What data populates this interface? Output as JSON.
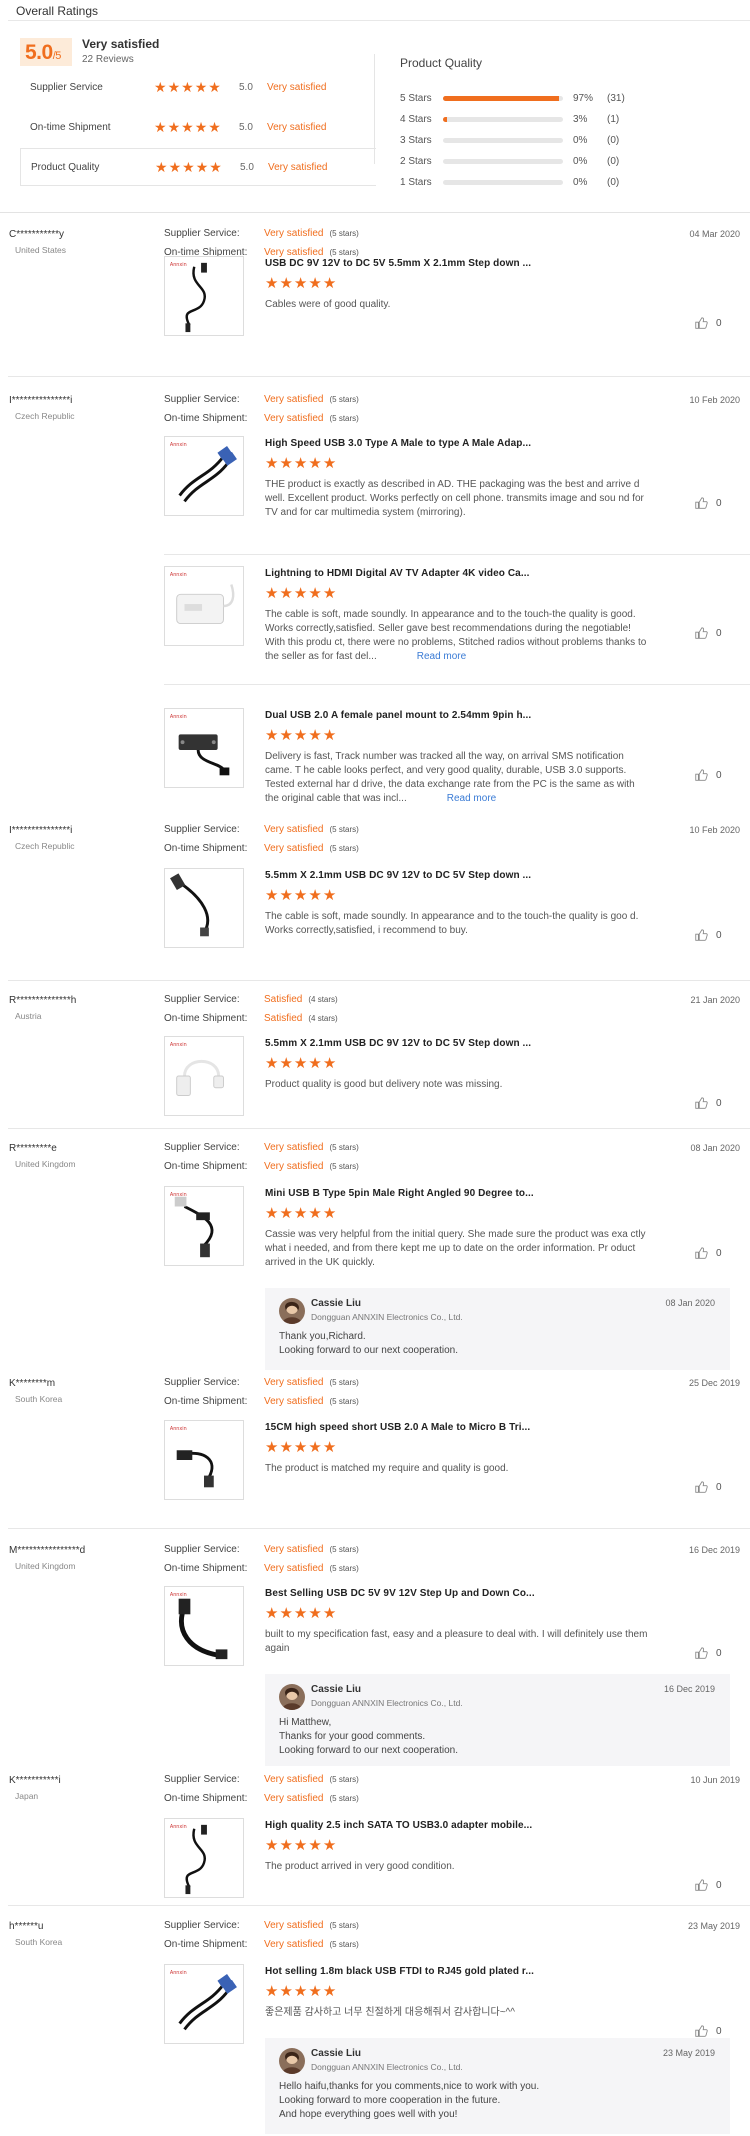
{
  "header": {
    "title": "Overall Ratings",
    "score": "5.0",
    "score_suffix": "/5",
    "score_label": "Very satisfied",
    "review_count": "22 Reviews"
  },
  "ratings": [
    {
      "label": "Supplier Service",
      "value": "5.0",
      "text": "Very satisfied"
    },
    {
      "label": "On-time Shipment",
      "value": "5.0",
      "text": "Very satisfied"
    },
    {
      "label": "Product Quality",
      "value": "5.0",
      "text": "Very satisfied"
    }
  ],
  "product_quality": {
    "title": "Product Quality",
    "bars": [
      {
        "label": "5 Stars",
        "fraction": 0.97,
        "pct": "97%",
        "count": "(31)"
      },
      {
        "label": "4 Stars",
        "fraction": 0.03,
        "pct": "3%",
        "count": "(1)"
      },
      {
        "label": "3 Stars",
        "fraction": 0,
        "pct": "0%",
        "count": "(0)"
      },
      {
        "label": "2 Stars",
        "fraction": 0,
        "pct": "0%",
        "count": "(0)"
      },
      {
        "label": "1 Stars",
        "fraction": 0,
        "pct": "0%",
        "count": "(0)"
      }
    ]
  },
  "labels": {
    "supplier_service": "Supplier Service:",
    "on_time_shipment": "On-time Shipment:",
    "read_more": "Read more"
  },
  "reviews": [
    {
      "user": "C***********y",
      "country": "United States",
      "date": "04 Mar 2020",
      "service": "Very satisfied",
      "service_stars": "(5 stars)",
      "shipment": "Very satisfied",
      "shipment_stars": "(5 stars)",
      "products": [
        {
          "name": "USB DC 9V 12V to DC 5V 5.5mm X 2.1mm Step down ...",
          "rating": 5,
          "text": "Cables were of good quality.",
          "likes": "0"
        }
      ]
    },
    {
      "user": "I***************i",
      "country": "Czech Republic",
      "date": "10 Feb 2020",
      "service": "Very satisfied",
      "service_stars": "(5 stars)",
      "shipment": "Very satisfied",
      "shipment_stars": "(5 stars)",
      "products": [
        {
          "name": "High Speed USB 3.0 Type A Male to type A Male Adap...",
          "rating": 5,
          "text": "THE product is exactly as described in AD. THE packaging was the best and arrive d well.  Excellent product. Works perfectly on cell phone. transmits image and sou nd for TV and for car multimedia system (mirroring).",
          "likes": "0"
        },
        {
          "name": "Lightning to HDMI Digital AV TV Adapter 4K video Ca...",
          "rating": 5,
          "text": "The cable is soft, made soundly. In appearance and to the touch-the quality is good. Works correctly,satisfied. Seller gave best recommendations during the negotiable! With this produ ct, there were no problems, Stitched radios without problems thanks to the seller as for fast del...",
          "likes": "0"
        },
        {
          "name": "Dual USB 2.0 A female panel mount to 2.54mm 9pin h...",
          "rating": 5,
          "text": "Delivery is fast,   Track number was tracked all the way, on arrival SMS notification came. T he cable looks perfect, and very good quality, durable, USB 3.0 supports. Tested external har d drive, the data exchange rate from the PC is the same as with the original cable that was incl...",
          "likes": "0"
        }
      ]
    },
    {
      "user": "I***************i",
      "country": "Czech Republic",
      "date": "10 Feb 2020",
      "service": "Very satisfied",
      "service_stars": "(5 stars)",
      "shipment": "Very satisfied",
      "shipment_stars": "(5 stars)",
      "products": [
        {
          "name": "5.5mm X 2.1mm USB DC 9V 12V to DC 5V Step down ...",
          "rating": 5,
          "text": "The cable is soft, made soundly. In appearance and to the touch-the quality is goo d. Works correctly,satisfied, i recommend to buy.",
          "likes": "0"
        }
      ]
    },
    {
      "user": "R**************h",
      "country": "Austria",
      "date": "21 Jan 2020",
      "service": "Satisfied",
      "service_stars": "(4 stars)",
      "shipment": "Satisfied",
      "shipment_stars": "(4 stars)",
      "products": [
        {
          "name": "5.5mm X 2.1mm USB DC 9V 12V to DC 5V Step down ...",
          "rating": 5,
          "text": "Product quality is good but delivery note was missing.",
          "likes": "0"
        }
      ]
    },
    {
      "user": "R*********e",
      "country": "United Kingdom",
      "date": "08 Jan 2020",
      "service": "Very satisfied",
      "service_stars": "(5 stars)",
      "shipment": "Very satisfied",
      "shipment_stars": "(5 stars)",
      "products": [
        {
          "name": "Mini USB B Type 5pin Male Right Angled 90 Degree to...",
          "rating": 5,
          "text": "Cassie was very helpful from the initial query. She made sure the product was exa ctly what i needed, and from there kept me up to date on the order information. Pr oduct arrived in the UK quickly.",
          "likes": "0"
        }
      ],
      "reply": {
        "name": "Cassie Liu",
        "company": "Dongguan ANNXIN Electronics Co., Ltd.",
        "date": "08 Jan 2020",
        "lines": [
          "Thank you,Richard.",
          "Looking forward to our next cooperation."
        ]
      }
    },
    {
      "user": "K********m",
      "country": "South Korea",
      "date": "25 Dec 2019",
      "service": "Very satisfied",
      "service_stars": "(5 stars)",
      "shipment": "Very satisfied",
      "shipment_stars": "(5 stars)",
      "products": [
        {
          "name": "15CM high speed short USB 2.0 A Male to Micro B Tri...",
          "rating": 5,
          "text": "The product is matched my require and quality is good.",
          "likes": "0"
        }
      ]
    },
    {
      "user": "M****************d",
      "country": "United Kingdom",
      "date": "16 Dec 2019",
      "service": "Very satisfied",
      "service_stars": "(5 stars)",
      "shipment": "Very satisfied",
      "shipment_stars": "(5 stars)",
      "products": [
        {
          "name": "Best Selling USB DC 5V 9V 12V Step Up and Down Co...",
          "rating": 5,
          "text": "built to my specification fast, easy and a pleasure to deal with. I will definitely use them again",
          "likes": "0"
        }
      ],
      "reply": {
        "name": "Cassie Liu",
        "company": "Dongguan ANNXIN Electronics Co., Ltd.",
        "date": "16 Dec 2019",
        "lines": [
          "Hi Matthew,",
          "Thanks for your good comments.",
          "Looking forward to our next cooperation."
        ]
      }
    },
    {
      "user": "K***********i",
      "country": "Japan",
      "date": "10 Jun 2019",
      "service": "Very satisfied",
      "service_stars": "(5 stars)",
      "shipment": "Very satisfied",
      "shipment_stars": "(5 stars)",
      "products": [
        {
          "name": "High quality 2.5 inch SATA TO USB3.0 adapter mobile...",
          "rating": 5,
          "text": "The product arrived in very good condition.",
          "likes": "0"
        }
      ]
    },
    {
      "user": "h******u",
      "country": "South Korea",
      "date": "23 May 2019",
      "service": "Very satisfied",
      "service_stars": "(5 stars)",
      "shipment": "Very satisfied",
      "shipment_stars": "(5 stars)",
      "products": [
        {
          "name": "Hot selling 1.8m black USB FTDI to RJ45 gold plated r...",
          "rating": 5,
          "text": "좋은제품 감사하고 너무 친절하게 대응해줘서 감사합니다~^^",
          "likes": "0"
        }
      ],
      "reply": {
        "name": "Cassie Liu",
        "company": "Dongguan ANNXIN Electronics Co., Ltd.",
        "date": "23 May 2019",
        "lines": [
          "Hello haifu,thanks for you comments,nice to work with you.",
          "Looking forward to more cooperation in the future.",
          "And hope everything goes well with you!"
        ]
      }
    }
  ]
}
